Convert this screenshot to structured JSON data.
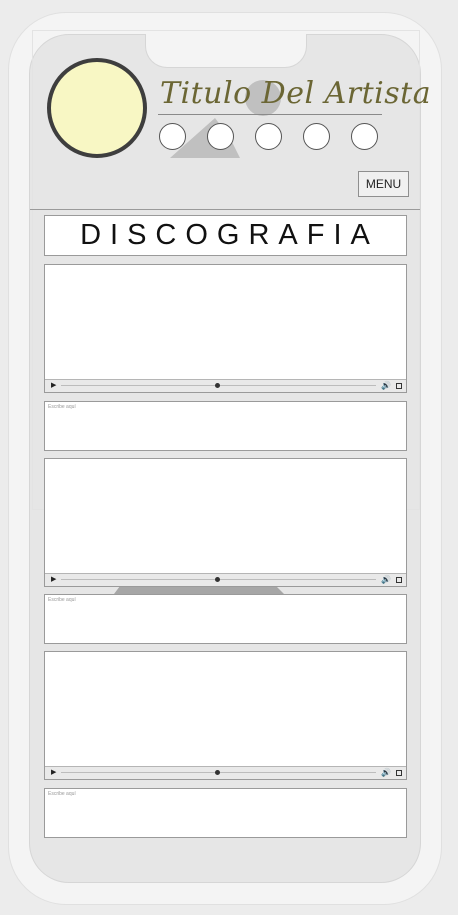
{
  "header": {
    "artist_title": "Titulo Del Artista",
    "menu_label": "MENU"
  },
  "section": {
    "title": "DISCOGRAFIA"
  },
  "social_links": [
    "social-1",
    "social-2",
    "social-3",
    "social-4",
    "social-5"
  ],
  "players": [
    {
      "controls": {
        "play": "▶",
        "volume": "🔊"
      }
    },
    {
      "controls": {
        "play": "▶",
        "volume": "🔊"
      }
    },
    {
      "controls": {
        "play": "▶",
        "volume": "🔊"
      }
    }
  ],
  "text_boxes": [
    {
      "placeholder": "Escribe aquí"
    },
    {
      "placeholder": "Escribe aquí"
    },
    {
      "placeholder": "Escribe aquí"
    }
  ],
  "colors": {
    "avatar_fill": "#f8f7c4",
    "title_color": "#6b6634",
    "screen_bg": "#e6e6e6"
  }
}
